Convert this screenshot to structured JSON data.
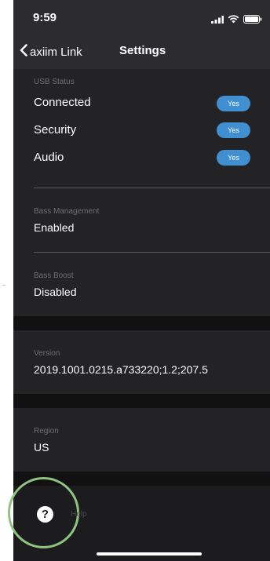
{
  "status_bar": {
    "time": "9:59"
  },
  "nav": {
    "back_label": "axiim Link",
    "title": "Settings"
  },
  "usb_status": {
    "header": "USB Status",
    "rows": [
      {
        "label": "Connected",
        "toggle": "Yes"
      },
      {
        "label": "Security",
        "toggle": "Yes"
      },
      {
        "label": "Audio",
        "toggle": "Yes"
      }
    ]
  },
  "bass_management": {
    "header": "Bass Management",
    "value": "Enabled"
  },
  "bass_boost": {
    "header": "Bass Boost",
    "value": "Disabled"
  },
  "version": {
    "header": "Version",
    "value": "2019.1001.0215.a733220;1.2;207.5"
  },
  "region": {
    "header": "Region",
    "value": "US"
  },
  "help": {
    "icon_glyph": "?",
    "label": "Help"
  },
  "colors": {
    "accent_toggle": "#3f8fd1",
    "highlight_circle": "#8fc37f",
    "background": "#1c1c1e"
  }
}
